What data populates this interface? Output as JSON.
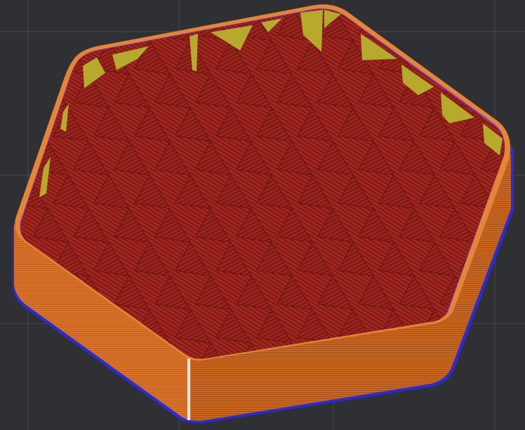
{
  "viewport": {
    "type": "3d-slicer-preview",
    "object": "hexagonal-print-layer"
  },
  "colors": {
    "background": "#2f3033",
    "grid_line": "#45474b",
    "outer_wall": "#d9722a",
    "outer_wall_dark": "#b55a1e",
    "outer_wall_top": "#e58535",
    "inner_wall": "#7a3fd1",
    "sparse_infill": "#a12620",
    "sparse_infill_line": "#6e1511",
    "solid_infill": "#b7a92c",
    "seam": "#e8e8e8",
    "bottom_edge": "#2a2ad8"
  },
  "icons": {
    "seam_marker": "seam-line-icon"
  }
}
